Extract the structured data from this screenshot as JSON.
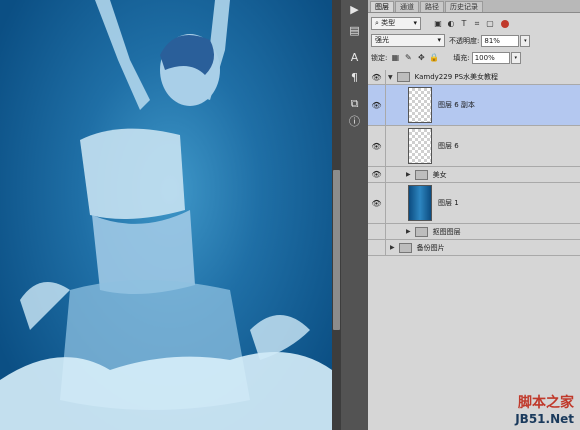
{
  "tabs": [
    "图层",
    "通道",
    "路径",
    "历史记录"
  ],
  "filter": {
    "label": "类型"
  },
  "blend": {
    "mode": "强光",
    "opacity_label": "不透明度:",
    "opacity": "81%"
  },
  "lock": {
    "label": "锁定:",
    "fill_label": "填充:",
    "fill": "100%"
  },
  "layers": [
    {
      "name": "Kamdy229 PS水美女教程",
      "kind": "group"
    },
    {
      "name": "图层 6 副本",
      "kind": "layer",
      "selected": true
    },
    {
      "name": "图层 6",
      "kind": "layer"
    },
    {
      "name": "美女",
      "kind": "group"
    },
    {
      "name": "图层 1",
      "kind": "layer"
    },
    {
      "name": "抠图图层",
      "kind": "group"
    },
    {
      "name": "备份图片",
      "kind": "group"
    }
  ],
  "watermark": {
    "line1": "脚本之家",
    "line2": "JB51.Net"
  },
  "colors": {
    "canvas_bg": "#1f6fa6",
    "selected_row": "#b4c8f0",
    "panel_bg": "#d6d6d6"
  }
}
